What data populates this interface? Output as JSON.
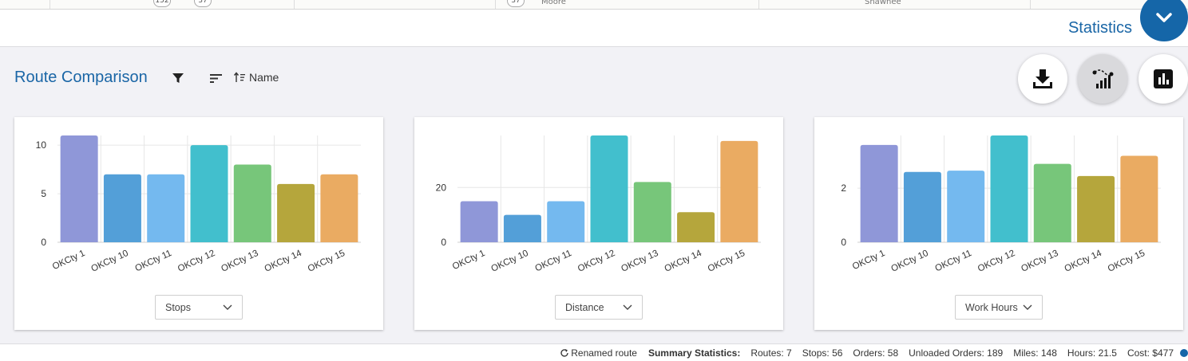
{
  "map": {
    "shields": [
      "152",
      "37",
      "37"
    ],
    "towns": [
      "Moore",
      "Shawnee"
    ]
  },
  "statistics": {
    "title": "Statistics",
    "collapse_icon": "chevron-down-icon"
  },
  "route_comparison": {
    "title": "Route Comparison",
    "sort_label": "Name",
    "actions": [
      {
        "name": "download-icon"
      },
      {
        "name": "route-chart-icon"
      },
      {
        "name": "bar-chart-icon"
      }
    ]
  },
  "colors": [
    "#8f97d8",
    "#539fd8",
    "#74b9ef",
    "#42bfcd",
    "#77c67a",
    "#b5a63c",
    "#eaab62"
  ],
  "chart_data": [
    {
      "type": "bar",
      "categories": [
        "OKCty 1",
        "OKCty 10",
        "OKCty 11",
        "OKCty 12",
        "OKCty 13",
        "OKCty 14",
        "OKCty 15"
      ],
      "values": [
        11,
        7,
        7,
        10,
        8,
        6,
        7
      ],
      "ylim": [
        0,
        11
      ],
      "yticks": [
        0,
        5,
        10
      ],
      "metric": "Stops",
      "grid": true
    },
    {
      "type": "bar",
      "categories": [
        "OKCty 1",
        "OKCty 10",
        "OKCty 11",
        "OKCty 12",
        "OKCty 13",
        "OKCty 14",
        "OKCty 15"
      ],
      "values": [
        15,
        10,
        15,
        39,
        22,
        11,
        37
      ],
      "ylim": [
        0,
        39
      ],
      "yticks": [
        0,
        20
      ],
      "metric": "Distance",
      "grid": true
    },
    {
      "type": "bar",
      "categories": [
        "OKCty 1",
        "OKCty 10",
        "OKCty 11",
        "OKCty 12",
        "OKCty 13",
        "OKCty 14",
        "OKCty 15"
      ],
      "values": [
        3.6,
        2.6,
        2.65,
        3.95,
        2.9,
        2.45,
        3.2
      ],
      "ylim": [
        0,
        3.95
      ],
      "yticks": [
        0,
        2
      ],
      "metric": "Work Hours",
      "grid": true
    }
  ],
  "footer": {
    "renamed": "Renamed route",
    "summary_label": "Summary Statistics:",
    "routes": "Routes: 7",
    "stops": "Stops: 56",
    "orders": "Orders: 58",
    "unloaded": "Unloaded Orders: 189",
    "miles": "Miles: 148",
    "hours": "Hours: 21.5",
    "cost": "Cost: $477"
  }
}
